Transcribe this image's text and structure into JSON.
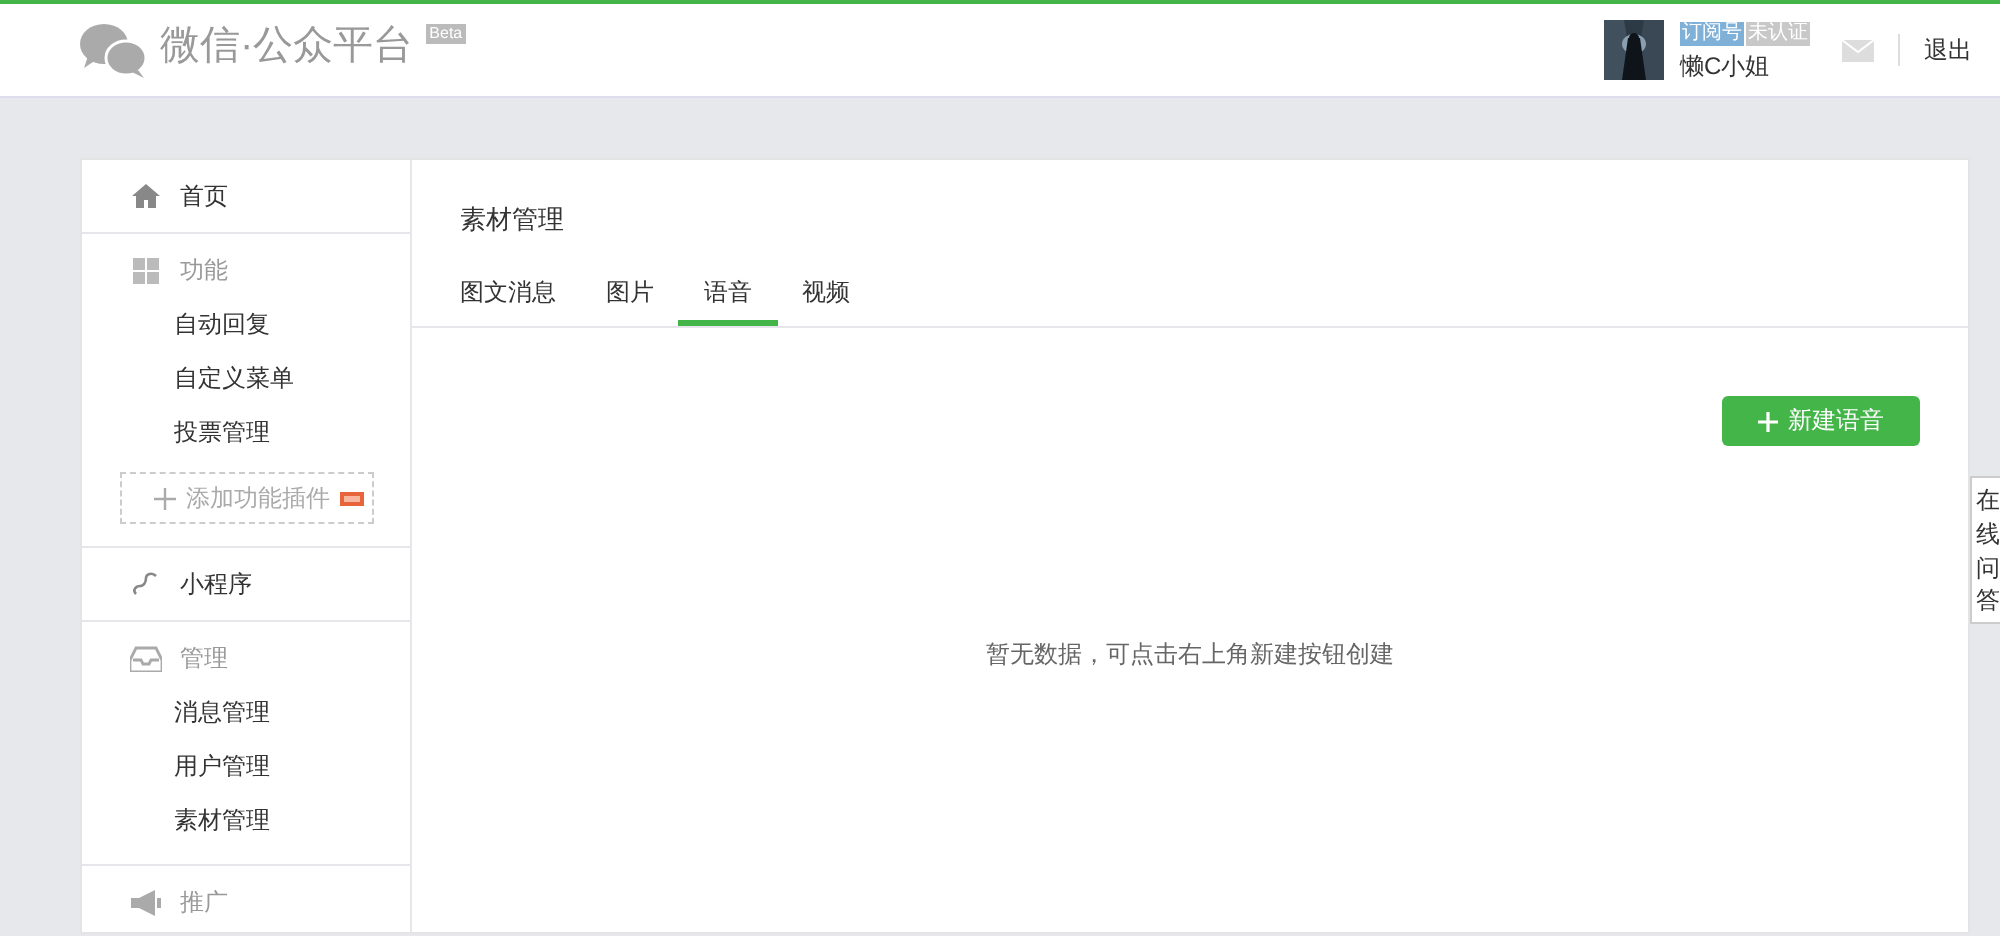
{
  "header": {
    "title": "微信·公众平台",
    "badge": "Beta",
    "account_tags": [
      {
        "label": "订阅号",
        "color": "#7fb0d8"
      },
      {
        "label": "未认证",
        "color": "#c8c8c8"
      }
    ],
    "username": "懒C小姐",
    "logout": "退出"
  },
  "sidebar": {
    "sections": [
      {
        "label": "首页",
        "kind": "link"
      },
      {
        "label": "功能",
        "kind": "group",
        "children": [
          {
            "label": "自动回复"
          },
          {
            "label": "自定义菜单"
          },
          {
            "label": "投票管理"
          }
        ],
        "add_button": "添加功能插件"
      },
      {
        "label": "小程序",
        "kind": "link"
      },
      {
        "label": "管理",
        "kind": "group",
        "children": [
          {
            "label": "消息管理"
          },
          {
            "label": "用户管理"
          },
          {
            "label": "素材管理"
          }
        ]
      },
      {
        "label": "推广",
        "kind": "group"
      }
    ]
  },
  "content": {
    "title": "素材管理",
    "tabs": [
      {
        "label": "图文消息",
        "selected": false
      },
      {
        "label": "图片",
        "selected": false
      },
      {
        "label": "语音",
        "selected": true
      },
      {
        "label": "视频",
        "selected": false
      }
    ],
    "new_button": "新建语音",
    "empty_text": "暂无数据，可点击右上角新建按钮创建"
  },
  "side_float": {
    "text": "在线问答"
  }
}
